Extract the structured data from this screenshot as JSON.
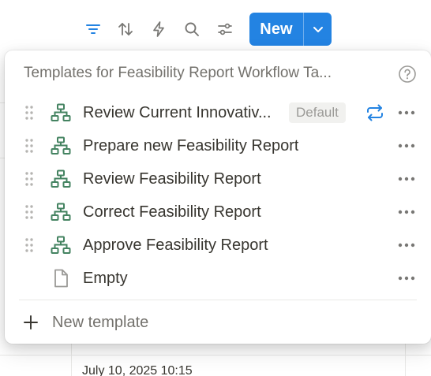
{
  "toolbar": {
    "icons": [
      "filter-icon",
      "sort-icon",
      "automation-icon",
      "search-icon",
      "settings-icon"
    ],
    "new_label": "New",
    "accent": "#2383e2"
  },
  "background": {
    "cell_fragment": "July 10, 2025 10:15"
  },
  "templates_popup": {
    "title": "Templates for Feasibility Report Workflow Ta...",
    "items": [
      {
        "label": "Review Current Innovativ...",
        "icon": "sitemap-icon",
        "badge": "Default",
        "repeat": true
      },
      {
        "label": "Prepare new Feasibility Report",
        "icon": "sitemap-icon"
      },
      {
        "label": "Review Feasibility Report",
        "icon": "sitemap-icon"
      },
      {
        "label": "Correct Feasibility Report",
        "icon": "sitemap-icon"
      },
      {
        "label": "Approve Feasibility Report",
        "icon": "sitemap-icon"
      },
      {
        "label": "Empty",
        "icon": "page-icon"
      }
    ],
    "new_template_label": "New template",
    "template_icon_color": "#448361"
  }
}
